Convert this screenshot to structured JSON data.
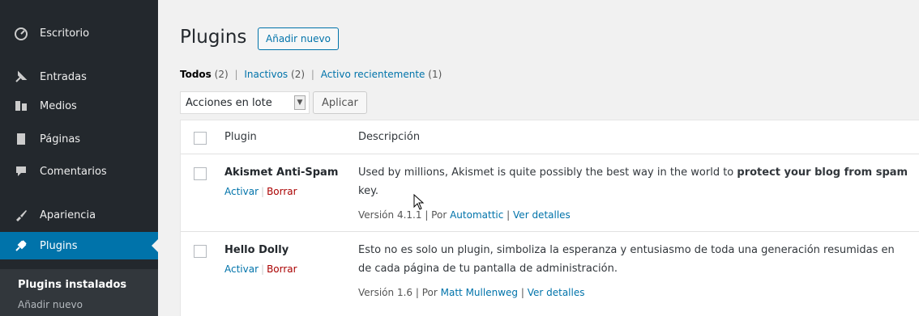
{
  "sidebar": {
    "items": [
      {
        "label": "Escritorio",
        "icon": "dashboard-icon"
      },
      {
        "label": "Entradas",
        "icon": "pin-icon"
      },
      {
        "label": "Medios",
        "icon": "media-icon"
      },
      {
        "label": "Páginas",
        "icon": "pages-icon"
      },
      {
        "label": "Comentarios",
        "icon": "comment-icon"
      },
      {
        "label": "Apariencia",
        "icon": "brush-icon"
      },
      {
        "label": "Plugins",
        "icon": "plugin-icon"
      }
    ],
    "submenu": {
      "current": "Plugins instalados",
      "add_new": "Añadir nuevo"
    }
  },
  "page": {
    "title": "Plugins",
    "add_new_label": "Añadir nuevo"
  },
  "filters": {
    "all_label": "Todos",
    "all_count": "(2)",
    "inactive_label": "Inactivos",
    "inactive_count": "(2)",
    "recent_label": "Activo recientemente",
    "recent_count": "(1)"
  },
  "bulk": {
    "selected": "Acciones en lote",
    "apply_label": "Aplicar"
  },
  "table": {
    "col_plugin": "Plugin",
    "col_desc": "Descripción",
    "rows": [
      {
        "name": "Akismet Anti-Spam",
        "activate": "Activar",
        "delete": "Borrar",
        "desc_plain": "Used by millions, Akismet is quite possibly the best way in the world to ",
        "desc_bold": "protect your blog from spam",
        "desc_line2": "key.",
        "version": "Versión 4.1.1",
        "by": "Por",
        "author": "Automattic",
        "details": "Ver detalles"
      },
      {
        "name": "Hello Dolly",
        "activate": "Activar",
        "delete": "Borrar",
        "desc_plain": "Esto no es solo un plugin, simboliza la esperanza y entusiasmo de toda una generación resumidas en",
        "desc_line2": "de cada página de tu pantalla de administración.",
        "version": "Versión 1.6",
        "by": "Por",
        "author": "Matt Mullenweg",
        "details": "Ver detalles"
      }
    ]
  },
  "colors": {
    "sidebar_bg": "#23282d",
    "active_bg": "#0073aa",
    "link": "#0073aa",
    "delete": "#a00000"
  }
}
